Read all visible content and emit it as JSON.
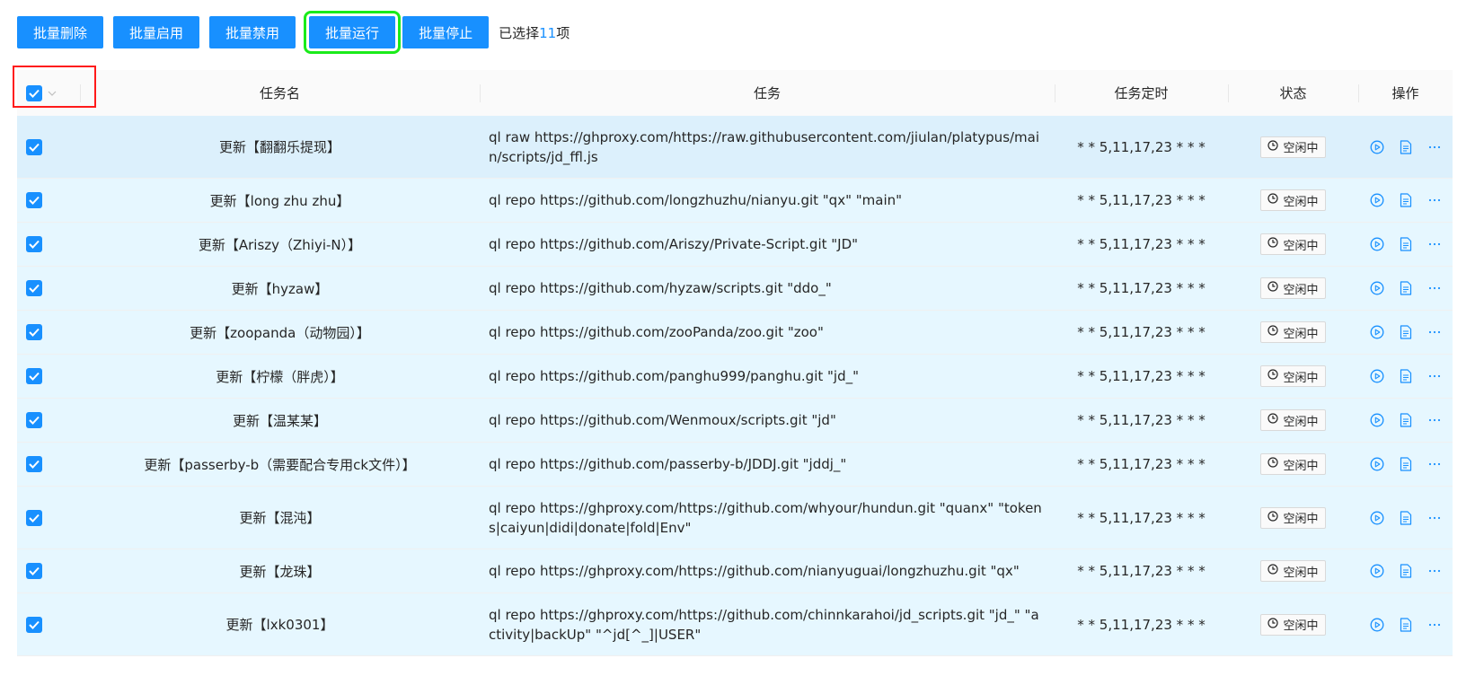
{
  "toolbar": {
    "buttons": [
      "批量删除",
      "批量启用",
      "批量禁用",
      "批量运行",
      "批量停止"
    ],
    "selection_prefix": "已选择",
    "selection_count": "11",
    "selection_suffix": "项"
  },
  "table": {
    "columns": [
      "任务名",
      "任务",
      "任务定时",
      "状态",
      "操作"
    ],
    "rows": [
      {
        "name": "更新【翻翻乐提现】",
        "task": "ql raw https://ghproxy.com/https://raw.githubusercontent.com/jiulan/platypus/main/scripts/jd_ffl.js",
        "cron": "* * 5,11,17,23 * * *",
        "status": "空闲中",
        "checked": true
      },
      {
        "name": "更新【long zhu zhu】",
        "task": "ql repo https://github.com/longzhuzhu/nianyu.git \"qx\" \"main\"",
        "cron": "* * 5,11,17,23 * * *",
        "status": "空闲中",
        "checked": true
      },
      {
        "name": "更新【Ariszy（Zhiyi-N）】",
        "task": "ql repo https://github.com/Ariszy/Private-Script.git \"JD\"",
        "cron": "* * 5,11,17,23 * * *",
        "status": "空闲中",
        "checked": true
      },
      {
        "name": "更新【hyzaw】",
        "task": "ql repo https://github.com/hyzaw/scripts.git \"ddo_\"",
        "cron": "* * 5,11,17,23 * * *",
        "status": "空闲中",
        "checked": true
      },
      {
        "name": "更新【zoopanda（动物园）】",
        "task": "ql repo https://github.com/zooPanda/zoo.git \"zoo\"",
        "cron": "* * 5,11,17,23 * * *",
        "status": "空闲中",
        "checked": true
      },
      {
        "name": "更新【柠檬（胖虎）】",
        "task": "ql repo https://github.com/panghu999/panghu.git \"jd_\"",
        "cron": "* * 5,11,17,23 * * *",
        "status": "空闲中",
        "checked": true
      },
      {
        "name": "更新【温某某】",
        "task": "ql repo https://github.com/Wenmoux/scripts.git \"jd\"",
        "cron": "* * 5,11,17,23 * * *",
        "status": "空闲中",
        "checked": true
      },
      {
        "name": "更新【passerby-b（需要配合专用ck文件）】",
        "task": "ql repo https://github.com/passerby-b/JDDJ.git \"jddj_\"",
        "cron": "* * 5,11,17,23 * * *",
        "status": "空闲中",
        "checked": true
      },
      {
        "name": "更新【混沌】",
        "task": "ql repo https://ghproxy.com/https://github.com/whyour/hundun.git \"quanx\" \"tokens|caiyun|didi|donate|fold|Env\"",
        "cron": "* * 5,11,17,23 * * *",
        "status": "空闲中",
        "checked": true
      },
      {
        "name": "更新【龙珠】",
        "task": "ql repo https://ghproxy.com/https://github.com/nianyuguai/longzhuzhu.git \"qx\"",
        "cron": "* * 5,11,17,23 * * *",
        "status": "空闲中",
        "checked": true
      },
      {
        "name": "更新【lxk0301】",
        "task": "ql repo https://ghproxy.com/https://github.com/chinnkarahoi/jd_scripts.git \"jd_\" \"activity|backUp\" \"^jd[^_]|USER\"",
        "cron": "* * 5,11,17,23 * * *",
        "status": "空闲中",
        "checked": true
      }
    ]
  },
  "colors": {
    "primary": "#1890ff",
    "selected_row": "#e6f7ff",
    "highlight_green": "#1aeb1a",
    "highlight_red": "#ff1a1a"
  },
  "icons": {
    "row_ops": [
      "play-circle-icon",
      "file-text-icon",
      "more-icon"
    ],
    "status": "clock-icon"
  }
}
